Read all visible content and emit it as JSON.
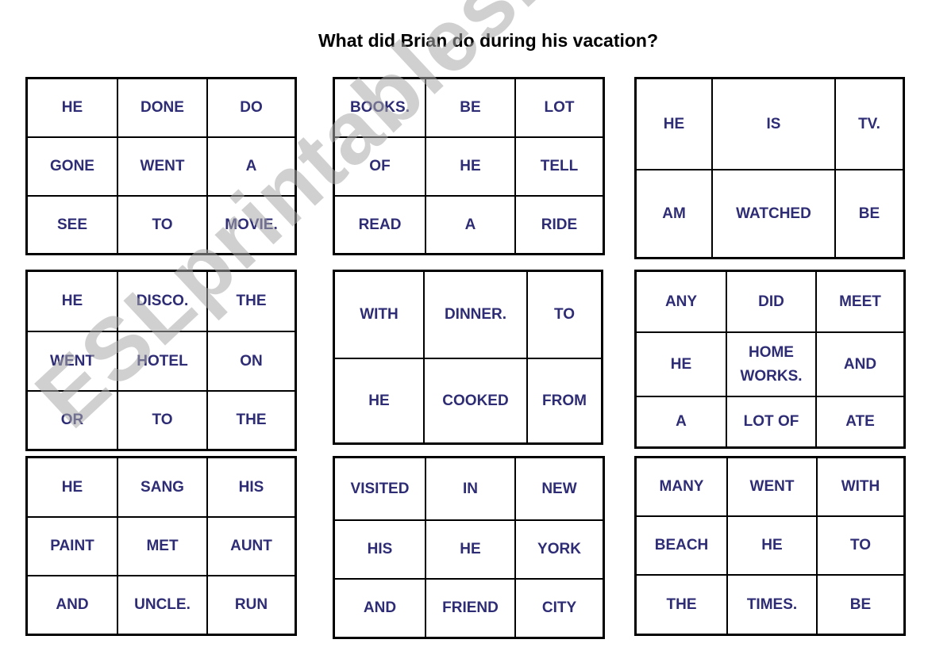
{
  "title": "What did Brian do during his vacation?",
  "watermark": "ESLprintables.com",
  "text_color": "#2e2c74",
  "grids": [
    {
      "rows": 3,
      "cols": 3,
      "cells": [
        "HE",
        "DONE",
        "DO",
        "GONE",
        "WENT",
        "A",
        "SEE",
        "TO",
        "MOVIE."
      ]
    },
    {
      "rows": 3,
      "cols": 3,
      "cells": [
        "BOOKS.",
        "BE",
        "LOT",
        "OF",
        "HE",
        "TELL",
        "READ",
        "A",
        "RIDE"
      ]
    },
    {
      "rows": 2,
      "cols": 3,
      "cells": [
        "HE",
        "IS",
        "TV.",
        "AM",
        "WATCHED",
        "BE"
      ]
    },
    {
      "rows": 3,
      "cols": 3,
      "cells": [
        "HE",
        "DISCO.",
        "THE",
        "WENT",
        "HOTEL",
        "ON",
        "OR",
        "TO",
        "THE"
      ]
    },
    {
      "rows": 2,
      "cols": 3,
      "cells": [
        "WITH",
        "DINNER.",
        "TO",
        "HE",
        "COOKED",
        "FROM"
      ]
    },
    {
      "rows": 3,
      "cols": 3,
      "cells": [
        "ANY",
        "DID",
        "MEET",
        "HE",
        "HOME\nWORKS.",
        "AND",
        "A",
        "LOT OF",
        "ATE"
      ]
    },
    {
      "rows": 3,
      "cols": 3,
      "cells": [
        "HE",
        "SANG",
        "HIS",
        "PAINT",
        "MET",
        "AUNT",
        "AND",
        "UNCLE.",
        "RUN"
      ]
    },
    {
      "rows": 3,
      "cols": 3,
      "cells": [
        "VISITED",
        "IN",
        "NEW",
        "HIS",
        "HE",
        "YORK",
        "AND",
        "FRIEND",
        "CITY"
      ]
    },
    {
      "rows": 3,
      "cols": 3,
      "cells": [
        "MANY",
        "WENT",
        "WITH",
        "BEACH",
        "HE",
        "TO",
        "THE",
        "TIMES.",
        "BE"
      ]
    }
  ]
}
